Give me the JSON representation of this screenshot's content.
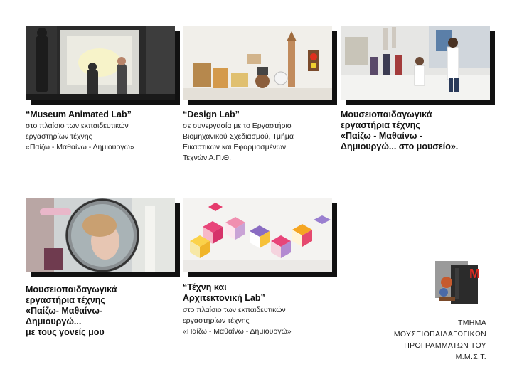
{
  "cards": [
    {
      "image": "workshop-shadow-theatre-photo",
      "title_lines": [
        "“Museum Animated Lab”"
      ],
      "sub_lines": [
        "στο πλαίσιο των εκπαιδευτικών",
        "εργαστηρίων τέχνης",
        "«Παίζω - Μαθαίνω - Δημιουργώ»"
      ]
    },
    {
      "image": "design-lab-objects-photo",
      "title_lines": [
        "“Design Lab”"
      ],
      "sub_lines": [
        "σε συνεργασία με το Εργαστήριο",
        "Βιομηχανικού Σχεδιασμού, Τμήμα",
        "Εικαστικών και Εφαρμοσμένων",
        "Τεχνών Α.Π.Θ."
      ]
    },
    {
      "image": "children-dancing-museum-photo",
      "title_lines": [
        "Μουσειοπαιδαγωγικά",
        "εργαστήρια τέχνης",
        "«Παίζω - Μαθαίνω -",
        "Δημιουργώ... στο μουσείο»."
      ],
      "sub_lines": []
    },
    {
      "image": "child-with-lens-photo",
      "title_lines": [
        "Μουσειοπαιδαγωγικά",
        "εργαστήρια τέχνης",
        "«Παίζω- Μαθαίνω-",
        "Δημιουργώ...",
        "με τους γονείς μου"
      ],
      "sub_lines": []
    },
    {
      "image": "paper-cube-structures-photo",
      "title_lines": [
        "“Τέχνη και",
        "Αρχιτεκτονική Lab”"
      ],
      "sub_lines": [
        "στο πλαίσιο των εκπαιδευτικών",
        "εργαστηρίων τέχνης",
        "«Παίζω - Μαθαίνω - Δημιουργώ»"
      ]
    }
  ],
  "logo": {
    "letter": "M",
    "icon": "museum-logo-icon",
    "colors": {
      "red": "#e02b20",
      "dark": "#2b2b2b",
      "gray": "#9a9a9a"
    }
  },
  "department": [
    "ΤΜΗΜΑ",
    "ΜΟΥΣΕΙΟΠΑΙΔΑΓΩΓΙΚΩΝ",
    "ΠΡΟΓΡΑΜΜΑΤΩΝ ΤΟΥ",
    "Μ.Μ.Σ.Τ."
  ]
}
